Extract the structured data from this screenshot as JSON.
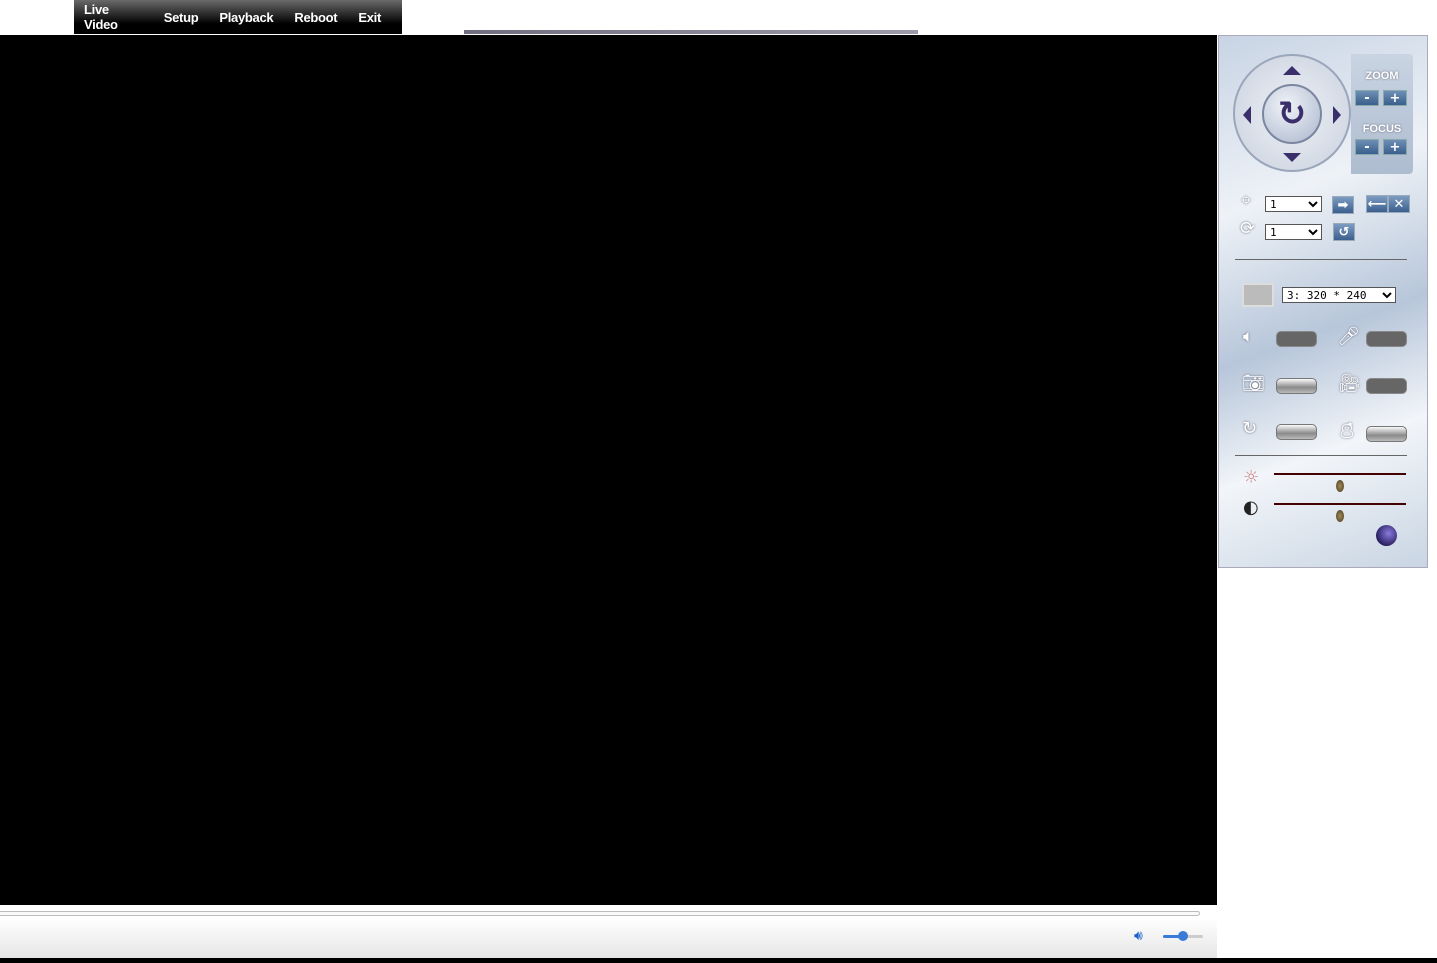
{
  "menu": {
    "items": [
      {
        "label": "Live Video"
      },
      {
        "label": "Setup"
      },
      {
        "label": "Playback"
      },
      {
        "label": "Reboot"
      },
      {
        "label": "Exit"
      }
    ]
  },
  "ptz": {
    "zoom_label": "ZOOM",
    "focus_label": "FOCUS",
    "minus": "-",
    "plus": "+",
    "center_icon": "↻",
    "preset": {
      "value": "1",
      "options": [
        "1"
      ]
    },
    "cruise": {
      "value": "1",
      "options": [
        "1"
      ]
    }
  },
  "stream": {
    "resolution": "3: 320 * 240",
    "options": [
      "3: 320 * 240"
    ]
  },
  "adjust": {
    "brightness": 0.5,
    "contrast": 0.5
  },
  "player": {
    "volume": 0.5
  },
  "icons": {
    "go": "➡",
    "set": "⟵",
    "delete": "✕",
    "cruise_run": "↺"
  }
}
